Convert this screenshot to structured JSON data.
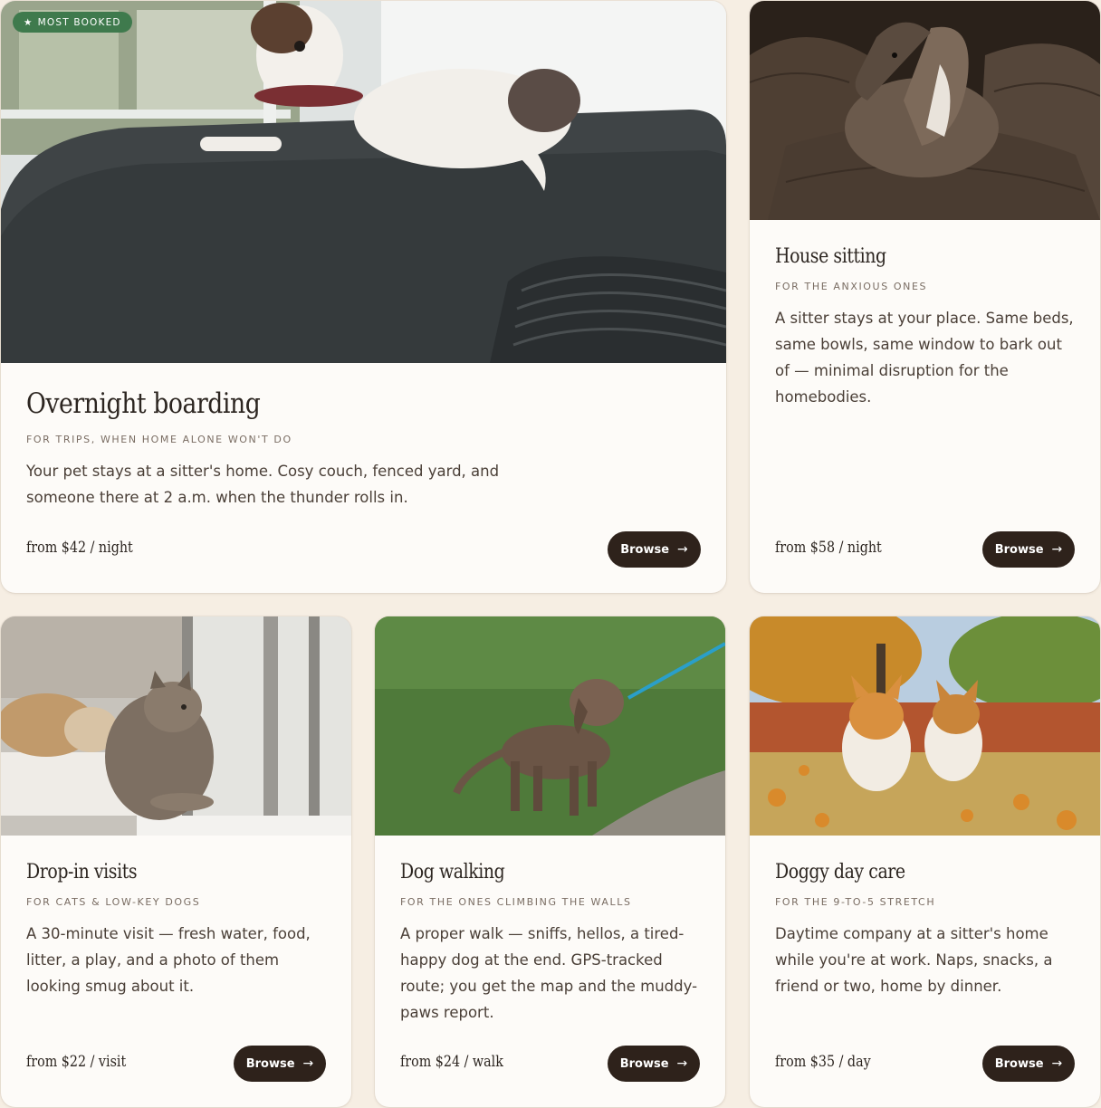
{
  "cards": [
    {
      "title": "Overnight boarding",
      "kicker": "FOR TRIPS, WHEN HOME ALONE WON'T DO",
      "description": "Your pet stays at a sitter's home. Cosy couch, fenced yard, and someone there at 2 a.m. when the thunder rolls in.",
      "price": "from $42 / night",
      "button": "Browse",
      "badge": "MOST BOOKED",
      "badge_icon": "star-icon",
      "photo": "dog-on-couch-photo"
    },
    {
      "title": "House sitting",
      "kicker": "FOR THE ANXIOUS ONES",
      "description": "A sitter stays at your place. Same beds, same bowls, same window to bark out of — minimal disruption for the homebodies.",
      "price": "from $58 / night",
      "button": "Browse",
      "photo": "greyhound-on-armchair-photo"
    },
    {
      "title": "Drop-in visits",
      "kicker": "FOR CATS & LOW-KEY DOGS",
      "description": "A 30-minute visit — fresh water, food, litter, a play, and a photo of them looking smug about it.",
      "price": "from $22 / visit",
      "button": "Browse",
      "photo": "cat-at-window-photo"
    },
    {
      "title": "Dog walking",
      "kicker": "FOR THE ONES CLIMBING THE WALLS",
      "description": "A proper walk — sniffs, hellos, a tired-happy dog at the end. GPS-tracked route; you get the map and the muddy-paws report.",
      "price": "from $24 / walk",
      "button": "Browse",
      "photo": "puppy-on-leash-photo"
    },
    {
      "title": "Doggy day care",
      "kicker": "FOR THE 9-TO-5 STRETCH",
      "description": "Daytime company at a sitter's home while you're at work. Naps, snacks, a friend or two, home by dinner.",
      "price": "from $35 / day",
      "button": "Browse",
      "photo": "corgis-in-leaves-photo"
    }
  ],
  "colors": {
    "background": "#f6eee3",
    "card": "#fdfbf8",
    "button": "#2e221b",
    "badge": "#3f7a4d"
  }
}
